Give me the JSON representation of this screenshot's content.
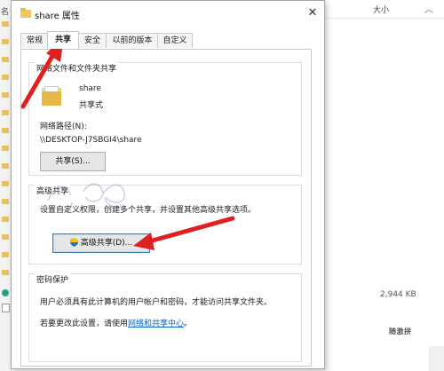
{
  "background": {
    "name_header_fragment": "名",
    "size_header": "大小",
    "file_size": "2,944 KB",
    "watermark_text": "随激拼"
  },
  "dialog": {
    "title": "share 属性",
    "tabs": [
      "常规",
      "共享",
      "安全",
      "以前的版本",
      "自定义"
    ],
    "active_tab": "共享",
    "network_sharing": {
      "group_title": "网络文件和文件夹共享",
      "folder_name": "share",
      "share_state": "共享式",
      "network_path_label": "网络路径(N):",
      "network_path": "\\\\DESKTOP-J7SBGI4\\share",
      "share_button": "共享(S)..."
    },
    "advanced_sharing": {
      "group_title": "高级共享",
      "description": "设置自定义权限，创建多个共享，并设置其他高级共享选项。",
      "button": "高级共享(D)..."
    },
    "password_protection": {
      "group_title": "密码保护",
      "description": "用户必须具有此计算机的用户帐户和密码，才能访问共享文件夹。",
      "change_text": "若要更改此设置，请使用",
      "link_text": "网络和共享中心",
      "trailing": "。"
    }
  },
  "colors": {
    "arrow": "#e02020",
    "link": "#0a63c9",
    "folder": "#e6b84a"
  }
}
